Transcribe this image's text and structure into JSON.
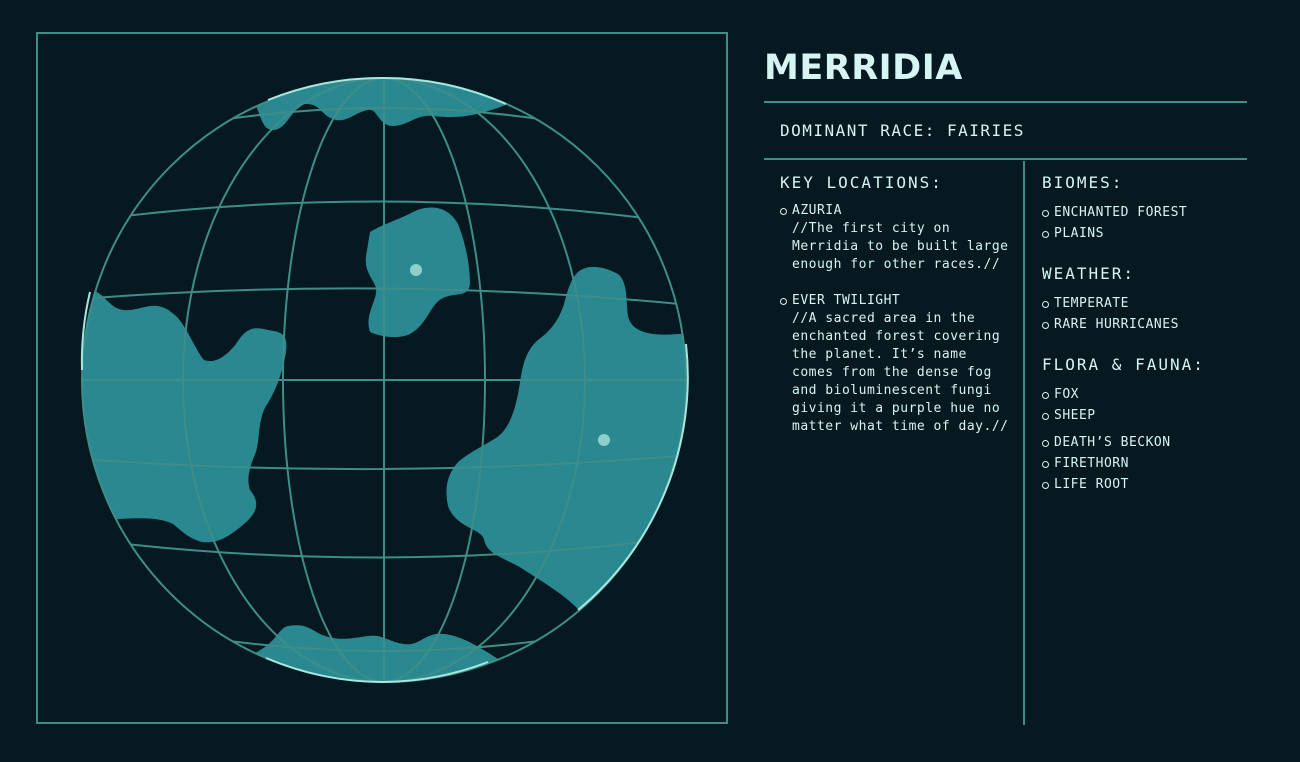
{
  "planet": {
    "name": "MERRIDIA",
    "dominant_race": "DOMINANT RACE: FAIRIES"
  },
  "key_locations": {
    "heading": "KEY LOCATIONS:",
    "items": [
      {
        "name": "AZURIA",
        "description": "//The first city on Merridia to be built large enough for other races.//"
      },
      {
        "name": "EVER TWILIGHT",
        "description": "//A sacred area in the enchanted forest covering the planet. It’s name comes from the dense fog and bioluminescent fungi giving it a purple hue no matter what time of day.//"
      }
    ]
  },
  "biomes": {
    "heading": "BIOMES:",
    "items": [
      "ENCHANTED FOREST",
      "PLAINS"
    ]
  },
  "weather": {
    "heading": "WEATHER:",
    "items": [
      "TEMPERATE",
      "RARE HURRICANES"
    ]
  },
  "flora_fauna": {
    "heading": "FLORA & FAUNA:",
    "fauna": [
      "FOX",
      "SHEEP"
    ],
    "flora": [
      "DEATH’S BECKON",
      "FIRETHORN",
      "LIFE ROOT"
    ]
  },
  "colors": {
    "background": "#061820",
    "line": "#3f8d88",
    "land": "#2a8890",
    "text": "#d6f4f1",
    "marker": "#8fd0cc"
  },
  "icons": {
    "globe": "planet-globe-icon",
    "bullet": "hollow-circle-bullet"
  }
}
